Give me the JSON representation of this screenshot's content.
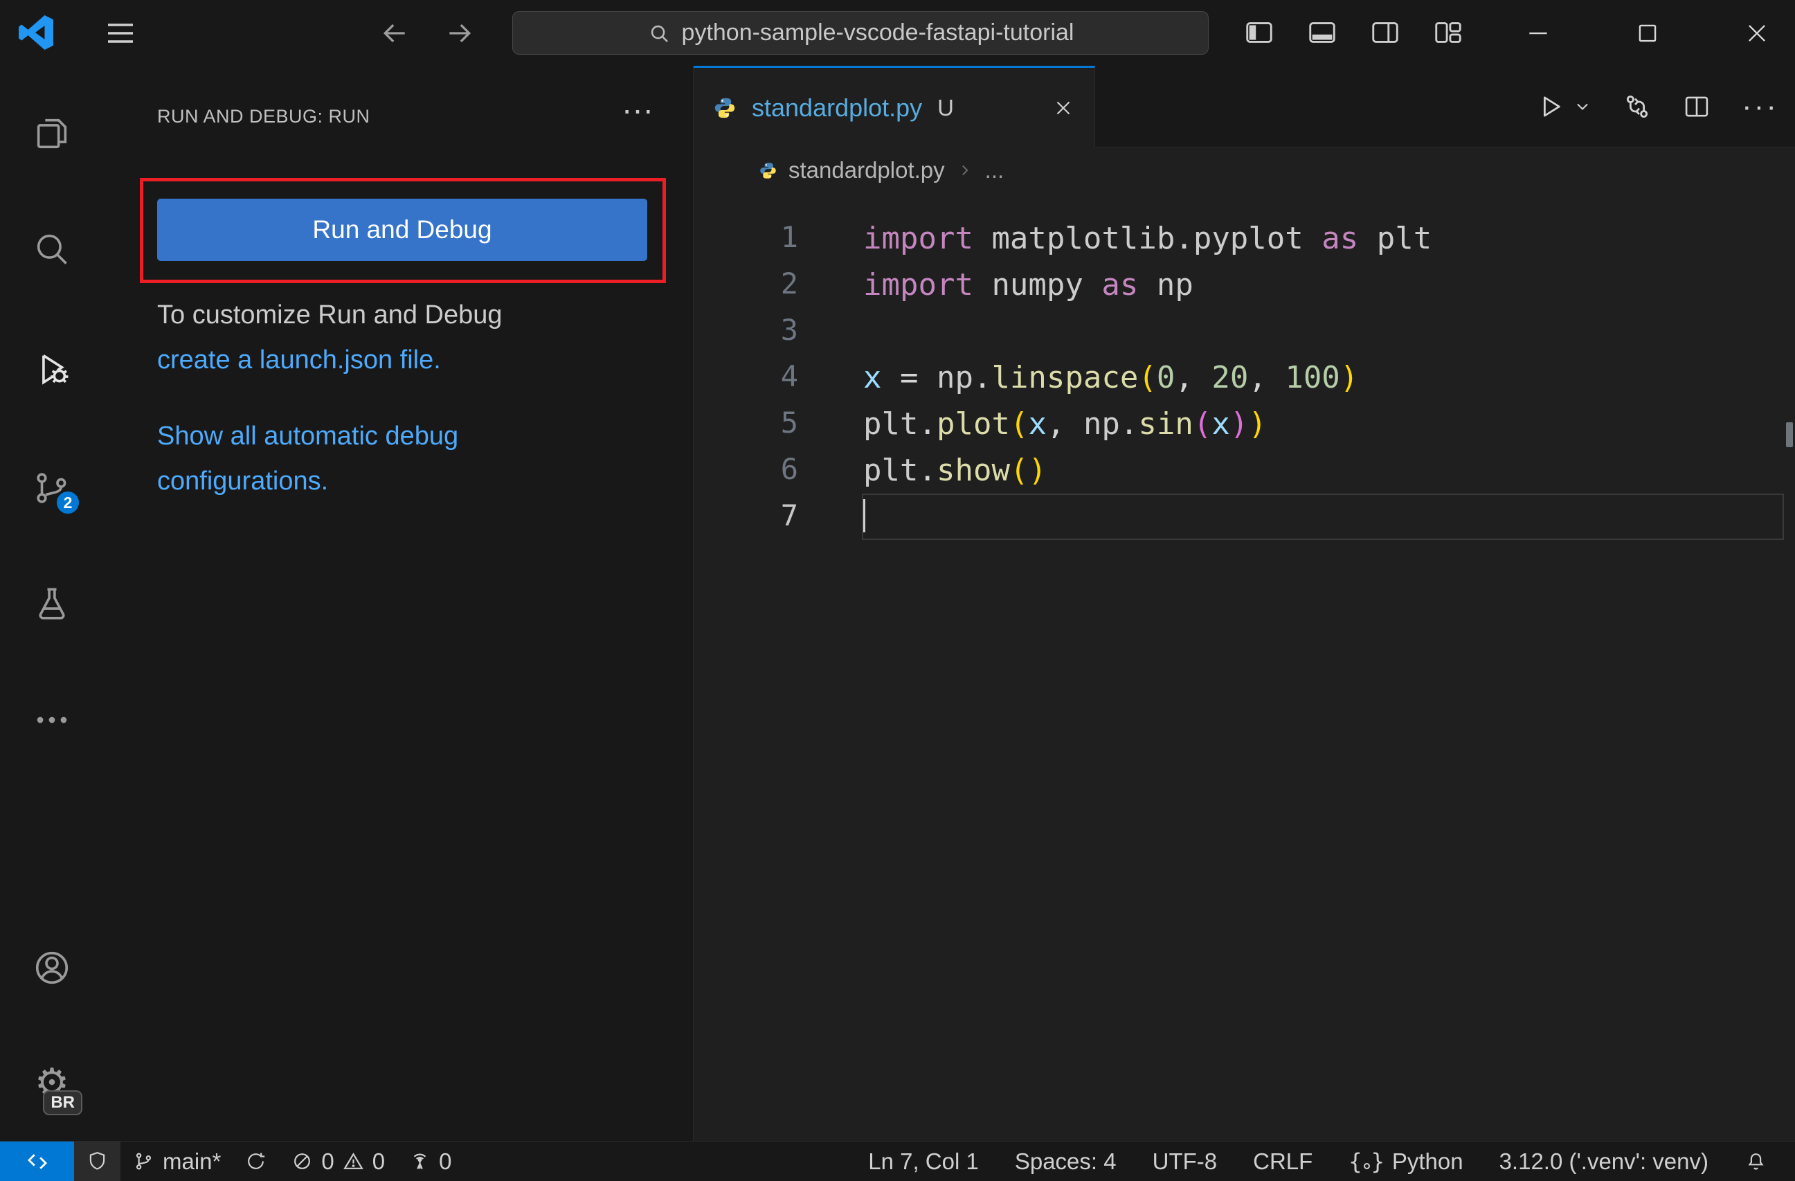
{
  "colors": {
    "accent": "#0078d4",
    "button": "#3574c9",
    "link": "#4daafc",
    "annotation_red": "#eb1d25",
    "tab_label_blue": "#58ace0",
    "editor_bg": "#1f1f1f",
    "chrome_bg": "#181818"
  },
  "titlebar": {
    "search_text": "python-sample-vscode-fastapi-tutorial"
  },
  "activity_bar": {
    "scm_badge": "2",
    "profile_badge": "BR",
    "gear_glyph": "⚙"
  },
  "sidebar": {
    "header": "RUN AND DEBUG: RUN",
    "more": "···",
    "run_button": "Run and Debug",
    "customize_text": "To customize Run and Debug",
    "customize_link": "create a launch.json file.",
    "showall_link_line1": "Show all automatic debug",
    "showall_link_line2": "configurations."
  },
  "editor": {
    "tab": {
      "label": "standardplot.py",
      "dirty": "U"
    },
    "breadcrumb": {
      "file": "standardplot.py",
      "more": "..."
    },
    "toolbar_more": "···",
    "lines": [
      {
        "n": "1",
        "tokens": [
          [
            "kw",
            "import "
          ],
          [
            "pl",
            "matplotlib.pyplot "
          ],
          [
            "kw",
            "as "
          ],
          [
            "pl",
            "plt"
          ]
        ]
      },
      {
        "n": "2",
        "tokens": [
          [
            "kw",
            "import "
          ],
          [
            "pl",
            "numpy "
          ],
          [
            "kw",
            "as "
          ],
          [
            "pl",
            "np"
          ]
        ]
      },
      {
        "n": "3",
        "tokens": []
      },
      {
        "n": "4",
        "tokens": [
          [
            "vr",
            "x "
          ],
          [
            "op",
            "= "
          ],
          [
            "pl",
            "np"
          ],
          [
            "op",
            "."
          ],
          [
            "fn",
            "linspace"
          ],
          [
            "b1",
            "("
          ],
          [
            "nm",
            "0"
          ],
          [
            "op",
            ", "
          ],
          [
            "nm",
            "20"
          ],
          [
            "op",
            ", "
          ],
          [
            "nm",
            "100"
          ],
          [
            "b1",
            ")"
          ]
        ]
      },
      {
        "n": "5",
        "tokens": [
          [
            "pl",
            "plt"
          ],
          [
            "op",
            "."
          ],
          [
            "fn",
            "plot"
          ],
          [
            "b1",
            "("
          ],
          [
            "vr",
            "x"
          ],
          [
            "op",
            ", "
          ],
          [
            "pl",
            "np"
          ],
          [
            "op",
            "."
          ],
          [
            "fn",
            "sin"
          ],
          [
            "b2",
            "("
          ],
          [
            "vr",
            "x"
          ],
          [
            "b2",
            ")"
          ],
          [
            "b1",
            ")"
          ]
        ]
      },
      {
        "n": "6",
        "tokens": [
          [
            "pl",
            "plt"
          ],
          [
            "op",
            "."
          ],
          [
            "fn",
            "show"
          ],
          [
            "b1",
            "("
          ],
          [
            "b1",
            ")"
          ]
        ]
      },
      {
        "n": "7",
        "tokens": [],
        "current": true
      }
    ]
  },
  "status_bar": {
    "branch": "main*",
    "errors": "0",
    "warnings": "0",
    "ports": "0",
    "line_col": "Ln 7, Col 1",
    "indent": "Spaces: 4",
    "encoding": "UTF-8",
    "eol": "CRLF",
    "language": "Python",
    "interpreter": "3.12.0 ('.venv': venv)"
  }
}
